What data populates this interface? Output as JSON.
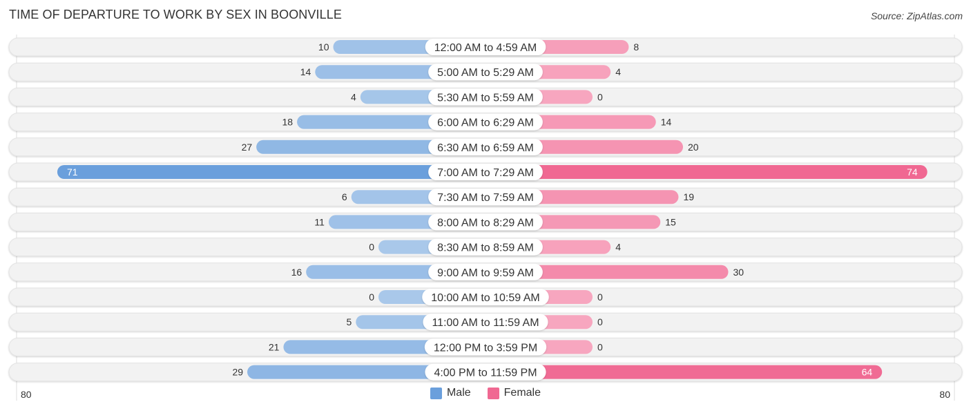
{
  "title": "TIME OF DEPARTURE TO WORK BY SEX IN BOONVILLE",
  "source": "Source: ZipAtlas.com",
  "legend": {
    "male_label": "Male",
    "female_label": "Female"
  },
  "colors": {
    "male_strong": "#6a9fdc",
    "male_light": "#a9c8ea",
    "female_strong": "#f06892",
    "female_light": "#f7a6bf",
    "track": "#f2f2f2",
    "label_bg": "#ffffff",
    "text": "#333333"
  },
  "chart_data": {
    "type": "bar",
    "orientation": "horizontal-diverging",
    "title": "TIME OF DEPARTURE TO WORK BY SEX IN BOONVILLE",
    "categories": [
      "12:00 AM to 4:59 AM",
      "5:00 AM to 5:29 AM",
      "5:30 AM to 5:59 AM",
      "6:00 AM to 6:29 AM",
      "6:30 AM to 6:59 AM",
      "7:00 AM to 7:29 AM",
      "7:30 AM to 7:59 AM",
      "8:00 AM to 8:29 AM",
      "8:30 AM to 8:59 AM",
      "9:00 AM to 9:59 AM",
      "10:00 AM to 10:59 AM",
      "11:00 AM to 11:59 AM",
      "12:00 PM to 3:59 PM",
      "4:00 PM to 11:59 PM"
    ],
    "series": [
      {
        "name": "Male",
        "side": "left",
        "values": [
          10,
          14,
          4,
          18,
          27,
          71,
          6,
          11,
          0,
          16,
          0,
          5,
          21,
          29
        ]
      },
      {
        "name": "Female",
        "side": "right",
        "values": [
          8,
          4,
          0,
          14,
          20,
          74,
          19,
          15,
          4,
          30,
          0,
          0,
          0,
          64
        ]
      }
    ],
    "axis": {
      "left_tick_label": "80",
      "right_tick_label": "80",
      "max": 80
    },
    "xlabel": "",
    "ylabel": "",
    "legend_position": "bottom-center",
    "grid": false
  }
}
